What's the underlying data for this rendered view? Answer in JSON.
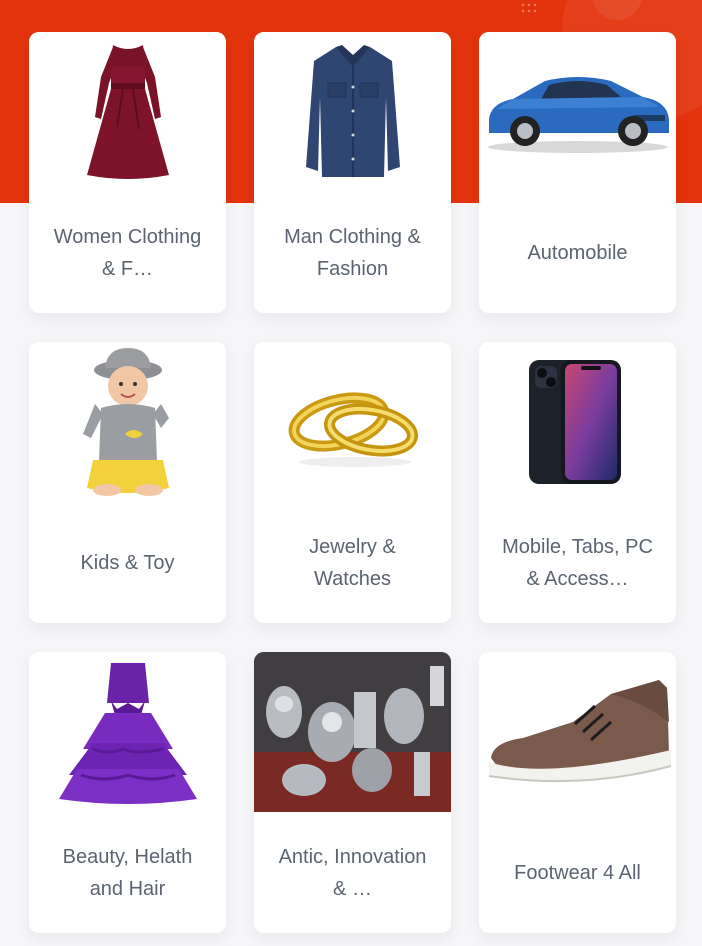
{
  "colors": {
    "header_background": "#e3330c",
    "page_background": "#f6f6f8",
    "card_background": "#ffffff",
    "label_text": "#5b6470"
  },
  "categories": [
    {
      "label": "Women Clothing & F…",
      "icon": "dress-icon"
    },
    {
      "label": "Man Clothing & Fashion",
      "icon": "shirt-icon"
    },
    {
      "label": "Automobile",
      "icon": "car-icon"
    },
    {
      "label": "Kids & Toy",
      "icon": "baby-icon"
    },
    {
      "label": "Jewelry & Watches",
      "icon": "rings-icon"
    },
    {
      "label": "Mobile, Tabs, PC & Access…",
      "icon": "smartphone-icon"
    },
    {
      "label": "Beauty, Helath and Hair",
      "icon": "party-dress-icon"
    },
    {
      "label": "Antic, Innovation & …",
      "icon": "antique-silverware-icon"
    },
    {
      "label": "Footwear 4 All",
      "icon": "shoe-icon"
    }
  ]
}
